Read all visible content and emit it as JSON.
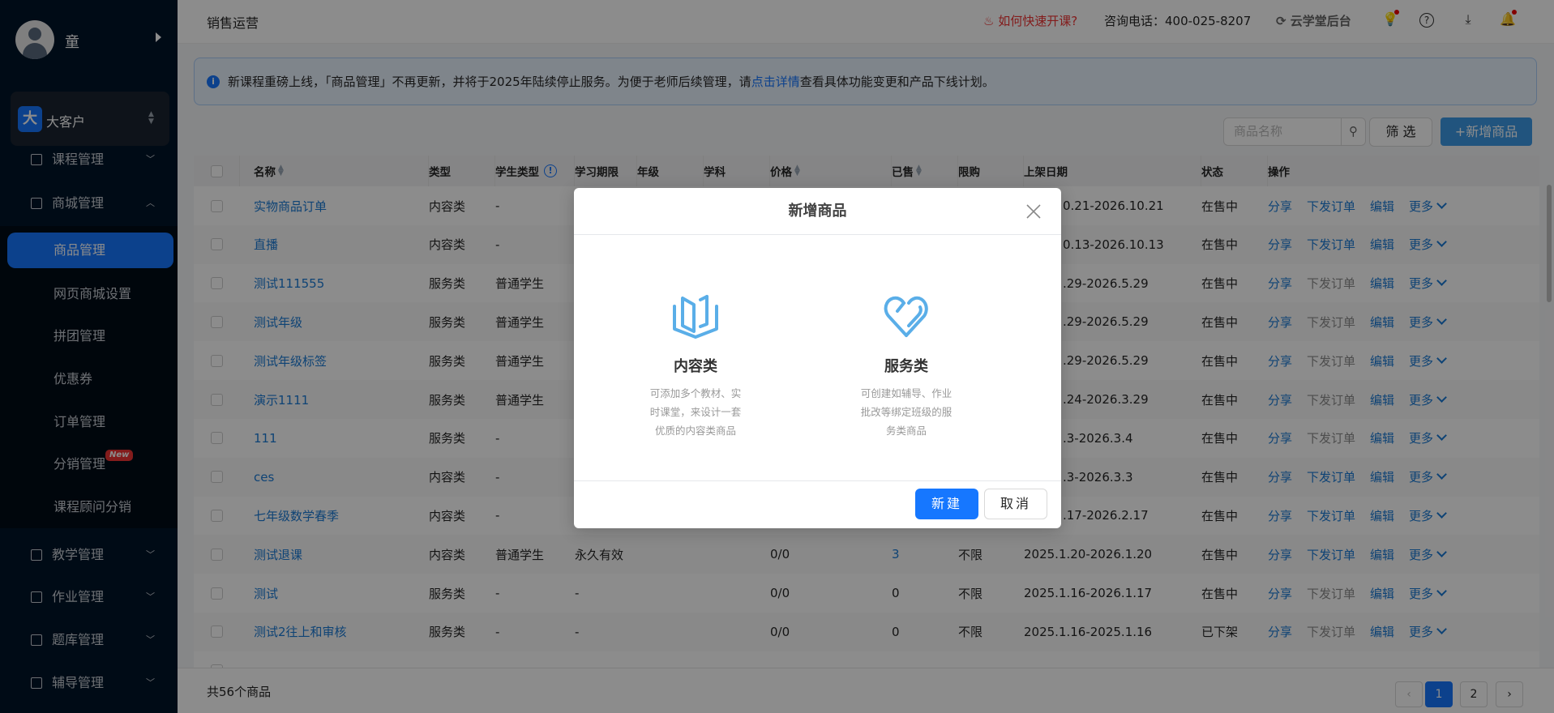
{
  "sidebar": {
    "user_name": "童",
    "org_badge": "大",
    "org_name": "大客户",
    "menu_top": [
      {
        "label": "课程管理"
      },
      {
        "label": "商城管理"
      }
    ],
    "submenu": [
      {
        "label": "商品管理",
        "active": true
      },
      {
        "label": "网页商城设置"
      },
      {
        "label": "拼团管理"
      },
      {
        "label": "优惠券"
      },
      {
        "label": "订单管理"
      },
      {
        "label": "分销管理",
        "badge": "New"
      },
      {
        "label": "课程顾问分销"
      }
    ],
    "menu_bottom": [
      {
        "label": "教学管理"
      },
      {
        "label": "作业管理"
      },
      {
        "label": "题库管理"
      },
      {
        "label": "辅导管理"
      }
    ]
  },
  "header": {
    "title": "销售运营",
    "quick_start": "如何快速开课?",
    "phone": "咨询电话：400-025-8207",
    "backend": "云学堂后台"
  },
  "banner": {
    "text_before": "新课程重磅上线，「商品管理」不再更新，并将于2025年陆续停止服务。为便于老师后续管理，请",
    "link": "点击详情",
    "text_after": "查看具体功能变更和产品下线计划。"
  },
  "toolbar": {
    "search_placeholder": "商品名称",
    "filter": "筛 选",
    "add": "+新增商品"
  },
  "table": {
    "columns": [
      "名称",
      "类型",
      "学生类型",
      "学习期限",
      "年级",
      "学科",
      "价格",
      "已售",
      "限购",
      "上架日期",
      "状态",
      "操作"
    ],
    "ops": {
      "share": "分享",
      "order": "下发订单",
      "edit": "编辑",
      "more": "更多"
    },
    "rows": [
      {
        "name": "实物商品订单",
        "type": "内容类",
        "stype": "-",
        "period": "",
        "grade": "",
        "subject": "",
        "price": "",
        "sold": "",
        "limit": "",
        "date": "0.21-2026.10.21",
        "status": "在售中",
        "order_enabled": true
      },
      {
        "name": "直播",
        "type": "内容类",
        "stype": "-",
        "period": "",
        "grade": "",
        "subject": "",
        "price": "",
        "sold": "",
        "limit": "",
        "date": "0.13-2026.10.13",
        "status": "在售中",
        "order_enabled": true
      },
      {
        "name": "测试111555",
        "type": "服务类",
        "stype": "普通学生",
        "period": "",
        "grade": "",
        "subject": "",
        "price": "",
        "sold": "",
        "limit": "",
        "date": ".29-2026.5.29",
        "status": "在售中",
        "order_enabled": false
      },
      {
        "name": "测试年级",
        "type": "服务类",
        "stype": "普通学生",
        "period": "",
        "grade": "",
        "subject": "",
        "price": "",
        "sold": "",
        "limit": "",
        "date": ".29-2026.5.29",
        "status": "在售中",
        "order_enabled": false
      },
      {
        "name": "测试年级标签",
        "type": "服务类",
        "stype": "普通学生",
        "period": "",
        "grade": "",
        "subject": "",
        "price": "",
        "sold": "",
        "limit": "",
        "date": ".29-2026.5.29",
        "status": "在售中",
        "order_enabled": false
      },
      {
        "name": "演示1111",
        "type": "服务类",
        "stype": "普通学生",
        "period": "",
        "grade": "",
        "subject": "",
        "price": "",
        "sold": "",
        "limit": "",
        "date": ".24-2026.3.29",
        "status": "在售中",
        "order_enabled": false
      },
      {
        "name": "111",
        "type": "服务类",
        "stype": "-",
        "period": "",
        "grade": "",
        "subject": "",
        "price": "",
        "sold": "",
        "limit": "",
        "date": ".3-2026.3.4",
        "status": "在售中",
        "order_enabled": false
      },
      {
        "name": "ces",
        "type": "内容类",
        "stype": "-",
        "period": "",
        "grade": "",
        "subject": "",
        "price": "",
        "sold": "",
        "limit": "",
        "date": ".3-2026.3.3",
        "status": "在售中",
        "order_enabled": true
      },
      {
        "name": "七年级数学春季",
        "type": "内容类",
        "stype": "-",
        "period": "",
        "grade": "",
        "subject": "",
        "price": "",
        "sold": "",
        "limit": "",
        "date": ".17-2026.2.17",
        "status": "在售中",
        "order_enabled": true
      },
      {
        "name": "测试退课",
        "type": "内容类",
        "stype": "普通学生",
        "period": "永久有效",
        "grade": "",
        "subject": "",
        "price": "0/0",
        "sold": "3",
        "sold_link": true,
        "limit": "不限",
        "date": "2025.1.20-2026.1.20",
        "status": "在售中",
        "order_enabled": true
      },
      {
        "name": "测试",
        "type": "服务类",
        "stype": "-",
        "period": "-",
        "grade": "",
        "subject": "",
        "price": "0/0",
        "sold": "0",
        "limit": "不限",
        "date": "2025.1.16-2026.1.17",
        "status": "在售中",
        "order_enabled": false
      },
      {
        "name": "测试2往上和审核",
        "type": "服务类",
        "stype": "-",
        "period": "-",
        "grade": "",
        "subject": "",
        "price": "0/0",
        "sold": "0",
        "limit": "不限",
        "date": "2025.1.16-2025.1.16",
        "status": "已下架",
        "order_enabled": false
      }
    ]
  },
  "footer": {
    "total": "共56个商品",
    "pages": [
      "1",
      "2"
    ],
    "current_page": "1"
  },
  "modal": {
    "title": "新增商品",
    "options": [
      {
        "title": "内容类",
        "desc": "可添加多个教材、实时课堂，来设计一套优质的内容类商品"
      },
      {
        "title": "服务类",
        "desc": "可创建如辅导、作业批改等绑定班级的服务类商品"
      }
    ],
    "ok": "新建",
    "cancel": "取消"
  },
  "colors": {
    "primary": "#1677ff",
    "icon": "#5aaee8",
    "warn": "#e33"
  }
}
